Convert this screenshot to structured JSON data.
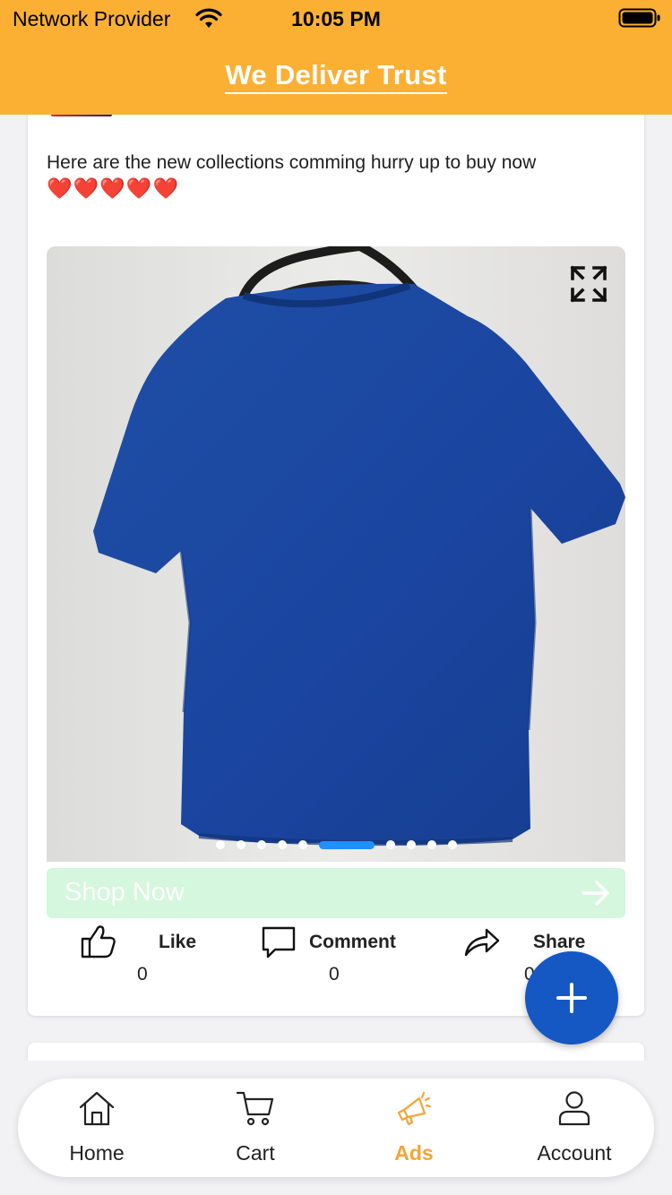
{
  "status_bar": {
    "carrier": "Network Provider",
    "time": "10:05 PM",
    "wifi_icon": "wifi-icon",
    "battery_icon": "battery-icon"
  },
  "header": {
    "title": "We Deliver Trust",
    "background_color": "#fbb034"
  },
  "post": {
    "text": "Here are the new collections comming hurry up to buy now",
    "hearts": "❤️❤️❤️❤️❤️",
    "media": {
      "description_icon": "tshirt-photo",
      "expand_icon": "expand-icon",
      "dot_count": 10,
      "active_dot_index": 4
    },
    "shop_now": {
      "label": "Shop Now",
      "icon": "arrow-right-icon",
      "color": "#d4f7dd"
    },
    "actions": {
      "like": {
        "label": "Like",
        "count": "0",
        "icon": "thumbs-up-icon"
      },
      "comment": {
        "label": "Comment",
        "count": "0",
        "icon": "comment-icon"
      },
      "share": {
        "label": "Share",
        "count": "0",
        "icon": "share-icon"
      }
    }
  },
  "fab": {
    "icon": "plus-icon",
    "color": "#1558c4"
  },
  "bottom_nav": {
    "items": [
      {
        "label": "Home",
        "icon": "home-icon",
        "active": false
      },
      {
        "label": "Cart",
        "icon": "cart-icon",
        "active": false
      },
      {
        "label": "Ads",
        "icon": "megaphone-icon",
        "active": true
      },
      {
        "label": "Account",
        "icon": "user-icon",
        "active": false
      }
    ],
    "active_color": "#f3a536"
  }
}
